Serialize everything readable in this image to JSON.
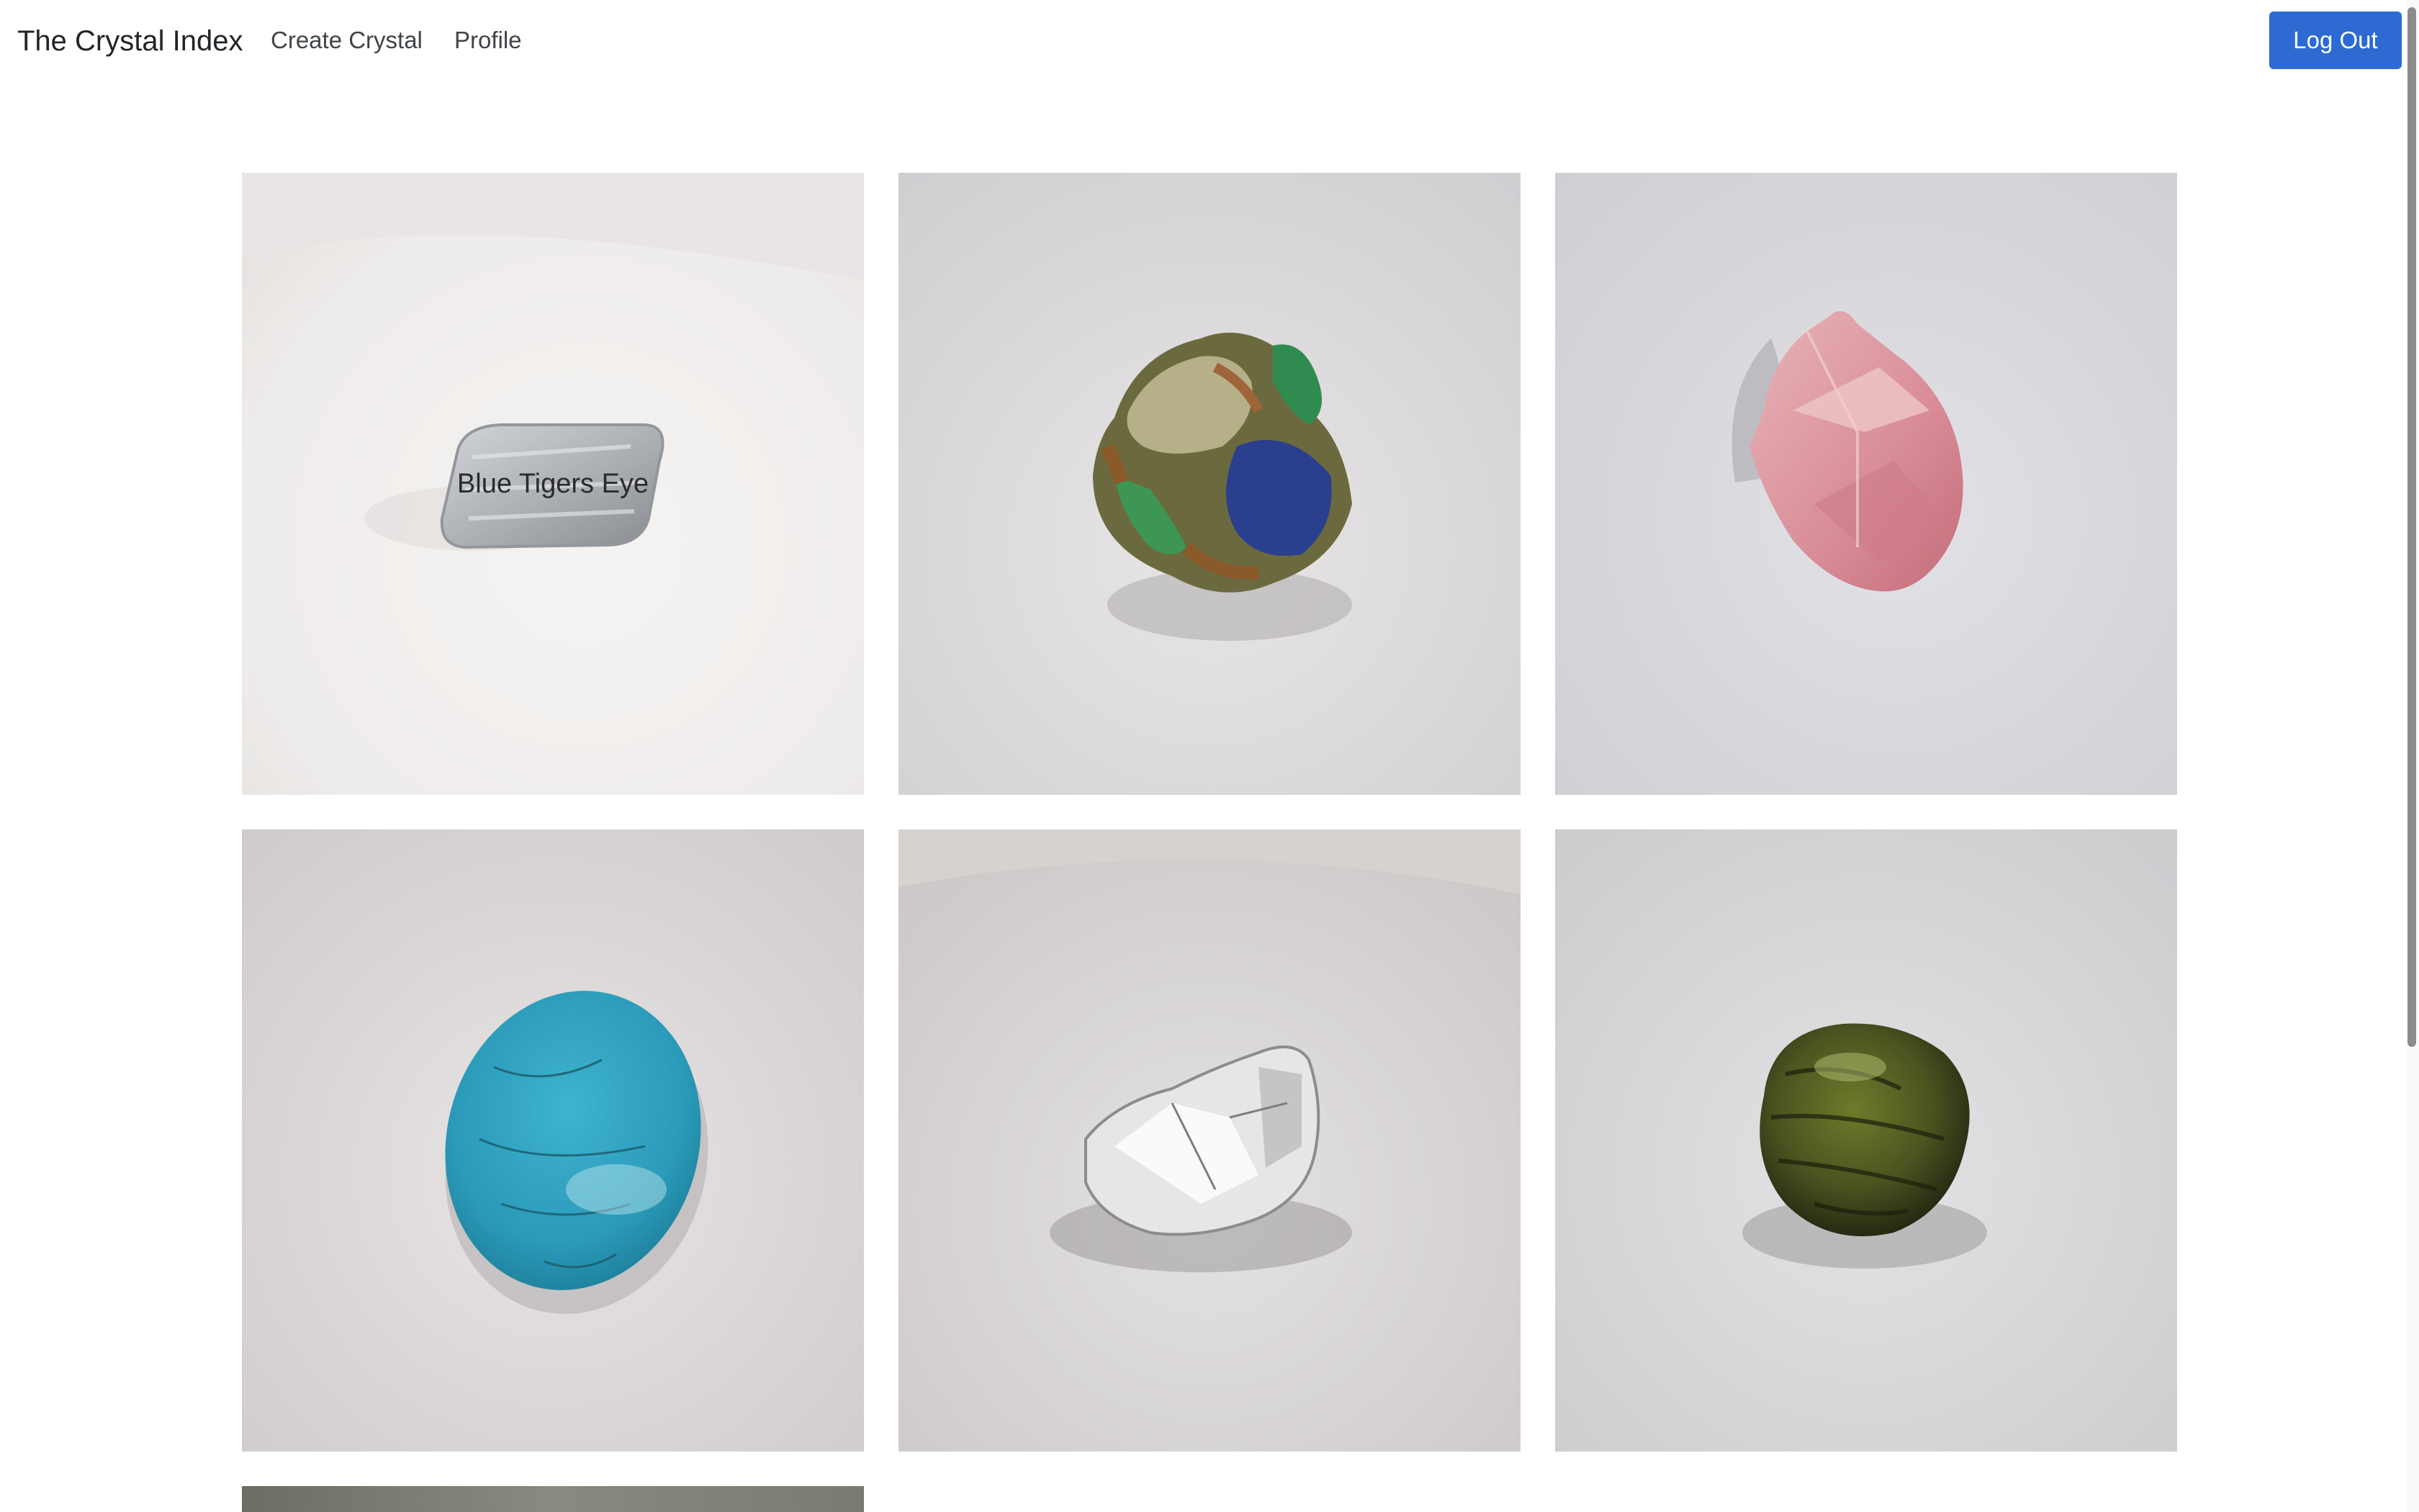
{
  "navbar": {
    "brand": "The Crystal Index",
    "links": [
      "Create Crystal",
      "Profile"
    ],
    "logout_label": "Log Out",
    "accent_color": "#2d6ad2"
  },
  "crystals": [
    {
      "name": "Blue Tigers Eye",
      "label_visible": true
    },
    {
      "name": "",
      "label_visible": false
    },
    {
      "name": "",
      "label_visible": false
    },
    {
      "name": "",
      "label_visible": false
    },
    {
      "name": "",
      "label_visible": false
    },
    {
      "name": "",
      "label_visible": false
    },
    {
      "name": "",
      "label_visible": false
    }
  ]
}
